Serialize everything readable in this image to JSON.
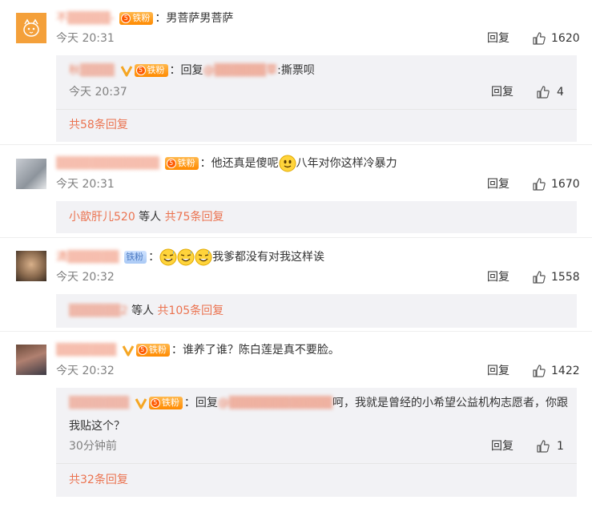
{
  "labels": {
    "reply": "回复",
    "fan_badge": "铁粉",
    "fan_level": "5",
    "reply_prefix": "回复"
  },
  "comments": [
    {
      "username": "不▒▒▒▒▒-",
      "text": "男菩萨男菩萨",
      "time": "今天 20:31",
      "likes": "1620",
      "replies": [
        {
          "username": "秋▒▒▒▒",
          "mention": "@▒▒▒▒▒▒草",
          "text": ":撕票呗",
          "time": "今天 20:37",
          "likes": "4"
        }
      ],
      "total": "共58条回复"
    },
    {
      "username": "▒▒▒▒▒▒▒▒▒▒▒▒",
      "text_before": "他还真是傻呢",
      "text_after": "八年对你这样冷暴力",
      "time": "今天 20:31",
      "likes": "1670",
      "summary_user": "小歆肝儿520",
      "summary_mid": " 等人 ",
      "summary_total": "共75条回复"
    },
    {
      "username": "清▒▒▒▒▒▒",
      "text": "我爹都没有对我这样诶",
      "time": "今天 20:32",
      "likes": "1558",
      "summary_user": "▒▒▒▒▒▒2",
      "summary_mid": " 等人 ",
      "summary_total": "共105条回复"
    },
    {
      "username": "▒▒▒▒▒▒▒",
      "text": "谁养了谁？陈白莲是真不要脸。",
      "time": "今天 20:32",
      "likes": "1422",
      "replies": [
        {
          "username": "▒▒▒▒▒▒▒",
          "mention": "@▒▒▒▒▒▒▒▒▒▒▒▒",
          "text_line1": "呵，我就是曾经的小希望公益机构志愿者，你跟",
          "text_line2": "我贴这个？",
          "time": "30分钟前",
          "likes": "1"
        }
      ],
      "total": "共32条回复"
    }
  ],
  "colors": {
    "accent": "#eb7350",
    "reply_bg": "#f2f2f5",
    "muted": "#808080"
  }
}
